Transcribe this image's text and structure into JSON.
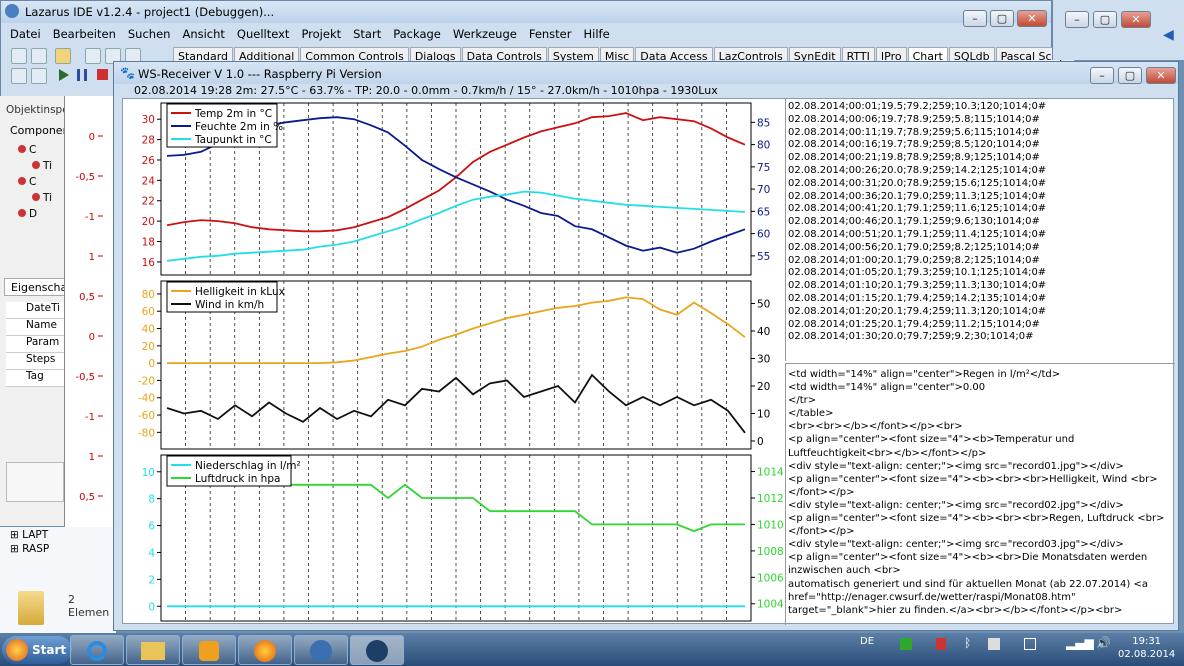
{
  "ide": {
    "title": "Lazarus IDE v1.2.4 - project1 (Debuggen)...",
    "menu": [
      "Datei",
      "Bearbeiten",
      "Suchen",
      "Ansicht",
      "Quelltext",
      "Projekt",
      "Start",
      "Package",
      "Werkzeuge",
      "Fenster",
      "Hilfe"
    ],
    "palette_tabs": [
      "Standard",
      "Additional",
      "Common Controls",
      "Dialogs",
      "Data Controls",
      "System",
      "Misc",
      "Data Access",
      "LazControls",
      "SynEdit",
      "RTTI",
      "IPro",
      "Chart",
      "SQLdb",
      "Pascal Script"
    ],
    "active_tab": "Chart"
  },
  "object_inspector": {
    "title": "Objektinspe",
    "components_label": "Componen",
    "props_tab": "Eigenschaf",
    "props": [
      "DateTi",
      "Name",
      "Param",
      "Steps",
      "Tag"
    ],
    "tree_items": [
      "C",
      "Ti",
      "C",
      "Ti",
      "D"
    ]
  },
  "explorer": {
    "items": [
      "LAPT",
      "RASP"
    ],
    "count_label": "2 Elemen"
  },
  "back_axis_labels": [
    "0",
    "-0,5",
    "-1",
    "1",
    "0,5",
    "0",
    "-0,5",
    "-1",
    "1",
    "0,5",
    "0",
    "-0,5",
    "-1"
  ],
  "ws": {
    "title": "WS-Receiver V 1.0 --- Raspberry Pi Version",
    "status": "02.08.2014 19:28 2m: 27.5°C - 63.7% - TP: 20.0 - 0.0mm - 0.7km/h / 15° - 27.0km/h - 1010hpa - 1930Lux",
    "log_lines": [
      "02.08.2014;00:01;19.5;79.2;259;10.3;120;1014;0#",
      "02.08.2014;00:06;19.7;78.9;259;5.8;115;1014;0#",
      "02.08.2014;00:11;19.7;78.9;259;5.6;115;1014;0#",
      "02.08.2014;00:16;19.7;78.9;259;8.5;120;1014;0#",
      "02.08.2014;00:21;19.8;78.9;259;8.9;125;1014;0#",
      "02.08.2014;00:26;20.0;78.9;259;14.2;125;1014;0#",
      "02.08.2014;00:31;20.0;78.9;259;15.6;125;1014;0#",
      "02.08.2014;00:36;20.1;79.0;259;11.3;125;1014;0#",
      "02.08.2014;00:41;20.1;79.1;259;11.6;125;1014;0#",
      "02.08.2014;00:46;20.1;79.1;259;9.6;130;1014;0#",
      "02.08.2014;00:51;20.1;79.1;259;11.4;125;1014;0#",
      "02.08.2014;00:56;20.1;79.0;259;8.2;125;1014;0#",
      "02.08.2014;01:00;20.1;79.0;259;8.2;125;1014;0#",
      "02.08.2014;01:05;20.1;79.3;259;10.1;125;1014;0#",
      "02.08.2014;01:10;20.1;79.3;259;11.3;130;1014;0#",
      "02.08.2014;01:15;20.1;79.4;259;14.2;135;1014;0#",
      "02.08.2014;01:20;20.1;79.4;259;11.3;120;1014;0#",
      "02.08.2014;01:25;20.1;79.4;259;11.2;15;1014;0#",
      "02.08.2014;01:30;20.0;79.7;259;9.2;30;1014;0#"
    ],
    "html_source": "<td width=\"14%\" align=\"center\">Regen in l/m²</td>\n<td width=\"14%\" align=\"center\">0.00\n</tr>\n</table>\n<br><br></b></font></p><br>\n<p align=\"center\"><font size=\"4\"><b>Temperatur und Luftfeuchtigkeit<br></b></font></p>\n<div style=\"text-align: center;\"><img src=\"record01.jpg\"></div>\n<p align=\"center\"><font size=\"4\"><b><br><br>Helligkeit, Wind <br></font></p>\n<div style=\"text-align: center;\"><img src=\"record02.jpg\"></div>\n<p align=\"center\"><font size=\"4\"><b><br><br>Regen, Luftdruck <br></font></p>\n<div style=\"text-align: center;\"><img src=\"record03.jpg\"></div>\n<p align=\"center\"><font size=\"4\"><b><br>Die Monatsdaten werden inzwischen auch <br>\nautomatisch generiert und sind für aktuellen Monat (ab 22.07.2014) <a href=\"http://enager.cwsurf.de/wetter/raspi/Monat08.htm\" target=\"_blank\">hier zu finden.</a><br></b></font></p><br>"
  },
  "chart_data": [
    {
      "type": "line",
      "title": "",
      "yleft_ticks": [
        "30",
        "28",
        "26",
        "24",
        "22",
        "20",
        "18",
        "16"
      ],
      "yright_ticks": [
        "85",
        "80",
        "75",
        "70",
        "65",
        "60",
        "55"
      ],
      "ylim_left": [
        15.5,
        31
      ],
      "ylim_right": [
        52.5,
        88
      ],
      "colors": {
        "temp": "#cc1111",
        "hum": "#0b1a8c",
        "dew": "#22dfe6"
      },
      "series": [
        {
          "name": "Temp 2m in °C",
          "axis": "left",
          "key": "temp",
          "values": [
            19.6,
            19.9,
            20.1,
            20.0,
            19.8,
            19.4,
            19.2,
            19.1,
            19.0,
            19.0,
            19.1,
            19.4,
            19.9,
            20.4,
            21.2,
            22.1,
            23.0,
            24.3,
            25.8,
            26.8,
            27.5,
            28.2,
            28.8,
            29.2,
            29.6,
            30.2,
            30.3,
            30.6,
            29.9,
            30.2,
            30.0,
            29.8,
            29.1,
            28.2,
            27.5
          ]
        },
        {
          "name": "Feuchte 2m in %",
          "axis": "left",
          "key": "hum",
          "values": [
            26.4,
            26.5,
            26.8,
            27.6,
            28.1,
            28.8,
            29.4,
            29.7,
            29.9,
            30.1,
            30.2,
            30.0,
            29.4,
            28.7,
            27.4,
            26.0,
            25.1,
            24.3,
            23.6,
            22.9,
            22.1,
            21.5,
            20.8,
            20.5,
            19.5,
            19.2,
            18.4,
            17.6,
            17.1,
            17.4,
            16.9,
            17.3,
            18.0,
            18.6,
            19.2
          ]
        },
        {
          "name": "Taupunkt in °C",
          "axis": "left",
          "key": "dew",
          "values": [
            16.1,
            16.3,
            16.5,
            16.6,
            16.8,
            16.9,
            17.0,
            17.1,
            17.2,
            17.5,
            17.7,
            18.0,
            18.5,
            19.0,
            19.5,
            20.2,
            20.8,
            21.5,
            22.1,
            22.4,
            22.6,
            22.9,
            22.8,
            22.5,
            22.2,
            22.0,
            21.8,
            21.6,
            21.5,
            21.4,
            21.3,
            21.2,
            21.1,
            21.0,
            20.9
          ]
        }
      ],
      "grid": true,
      "legend": "top-left"
    },
    {
      "type": "line",
      "yleft_ticks": [
        "80",
        "60",
        "40",
        "20",
        "0",
        "-20",
        "-40",
        "-60",
        "-80"
      ],
      "yright_ticks": [
        "50",
        "40",
        "30",
        "20",
        "10",
        "0"
      ],
      "ylim_left": [
        -90,
        88
      ],
      "ylim_right": [
        0,
        56
      ],
      "colors": {
        "lux": "#eaa51a",
        "wind": "#111111"
      },
      "series": [
        {
          "name": "Helligkeit in kLux",
          "axis": "left",
          "key": "lux",
          "values": [
            0,
            0,
            0,
            0,
            0,
            0,
            0,
            0,
            0,
            0,
            1,
            3,
            7,
            11,
            14,
            19,
            27,
            33,
            40,
            46,
            52,
            56,
            60,
            64,
            66,
            70,
            72,
            76,
            74,
            62,
            56,
            70,
            58,
            45,
            30
          ]
        },
        {
          "name": "Wind in km/h",
          "axis": "right",
          "key": "wind",
          "values": [
            12,
            10,
            11,
            8,
            13,
            9,
            14,
            10,
            7,
            12,
            8,
            11,
            9,
            15,
            13,
            19,
            18,
            23,
            17,
            21,
            22,
            16,
            18,
            20,
            14,
            24,
            18,
            13,
            16,
            13,
            16,
            13,
            15,
            11,
            3
          ]
        }
      ],
      "grid": true,
      "legend": "top-left"
    },
    {
      "type": "line",
      "yleft_ticks": [
        "10",
        "8",
        "6",
        "4",
        "2",
        "0"
      ],
      "yright_ticks": [
        "1014",
        "1012",
        "1010",
        "1008",
        "1006",
        "1004"
      ],
      "ylim_left": [
        -0.5,
        10.8
      ],
      "ylim_right": [
        1003.3,
        1014.8
      ],
      "colors": {
        "rain": "#22dfe6",
        "pressure": "#2ed82e"
      },
      "series": [
        {
          "name": "Niederschlag in l/m²",
          "axis": "left",
          "key": "rain",
          "values": [
            0,
            0,
            0,
            0,
            0,
            0,
            0,
            0,
            0,
            0,
            0,
            0,
            0,
            0,
            0,
            0,
            0,
            0,
            0,
            0,
            0,
            0,
            0,
            0,
            0,
            0,
            0,
            0,
            0,
            0,
            0,
            0,
            0,
            0,
            0
          ]
        },
        {
          "name": "Luftdruck in hpa",
          "axis": "right",
          "key": "pressure",
          "values": [
            1014,
            1014,
            1014,
            1013,
            1013,
            1013,
            1013,
            1013,
            1013,
            1013,
            1013,
            1013,
            1013,
            1012,
            1013,
            1012,
            1012,
            1012,
            1012,
            1011,
            1011,
            1011,
            1011,
            1011,
            1011,
            1010,
            1010,
            1010,
            1010,
            1010,
            1010,
            1009.5,
            1010,
            1010,
            1010
          ]
        }
      ],
      "grid": true,
      "legend": "top-left"
    }
  ],
  "taskbar": {
    "start_label": "Start",
    "apps": [
      "internet-explorer-icon",
      "folder-icon",
      "media-player-icon",
      "firefox-icon",
      "lazarus-icon",
      "paw-icon"
    ],
    "lang": "DE",
    "time": "19:31",
    "date": "02.08.2014"
  }
}
